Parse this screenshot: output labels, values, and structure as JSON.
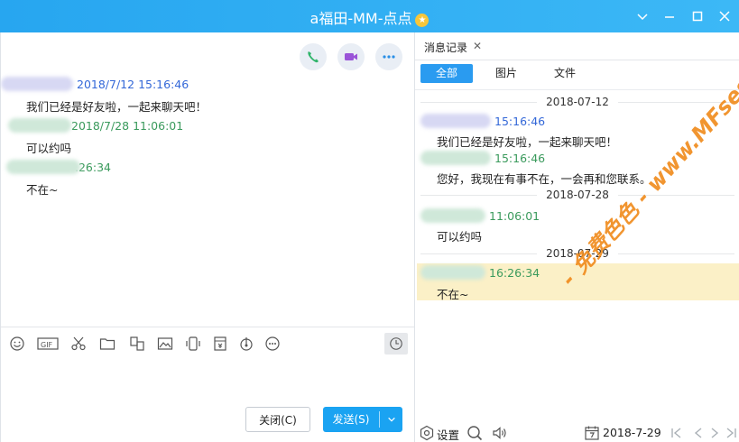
{
  "window": {
    "title": "a福田-MM-点点",
    "star_badge": "★"
  },
  "colors": {
    "titlebar": "#2fafef",
    "accent": "#1aa3f2",
    "time_self": "#3468d8",
    "time_other": "#3a9a5c",
    "highlight": "#fbf0c7"
  },
  "chat": {
    "messages": [
      {
        "time": "2018/7/12 15:16:46",
        "text": "我们已经是好友啦，一起来聊天吧！"
      },
      {
        "time": "2018/7/28 11:06:01",
        "text": "可以约吗"
      },
      {
        "time": ".26:34",
        "text": "不在~"
      }
    ]
  },
  "composer": {
    "close_label": "关闭(C)",
    "send_label": "发送(S)"
  },
  "history": {
    "tab_label": "消息记录",
    "filters": [
      "全部",
      "图片",
      "文件"
    ],
    "groups": [
      {
        "date": "2018-07-12",
        "entries": [
          {
            "time": "15:16:46",
            "text": "我们已经是好友啦，一起来聊天吧！"
          },
          {
            "time": "15:16:46",
            "text": "您好，我现在有事不在，一会再和您联系。"
          }
        ]
      },
      {
        "date": "2018-07-28",
        "entries": [
          {
            "time": "11:06:01",
            "text": "可以约吗"
          }
        ]
      },
      {
        "date": "2018-07-29",
        "entries": [
          {
            "time": "16:26:34",
            "text": "不在~"
          }
        ]
      }
    ],
    "settings_label": "设置",
    "current_date": "2018-7-29"
  },
  "watermark": "- 免费色色 - www.MFsese.com"
}
